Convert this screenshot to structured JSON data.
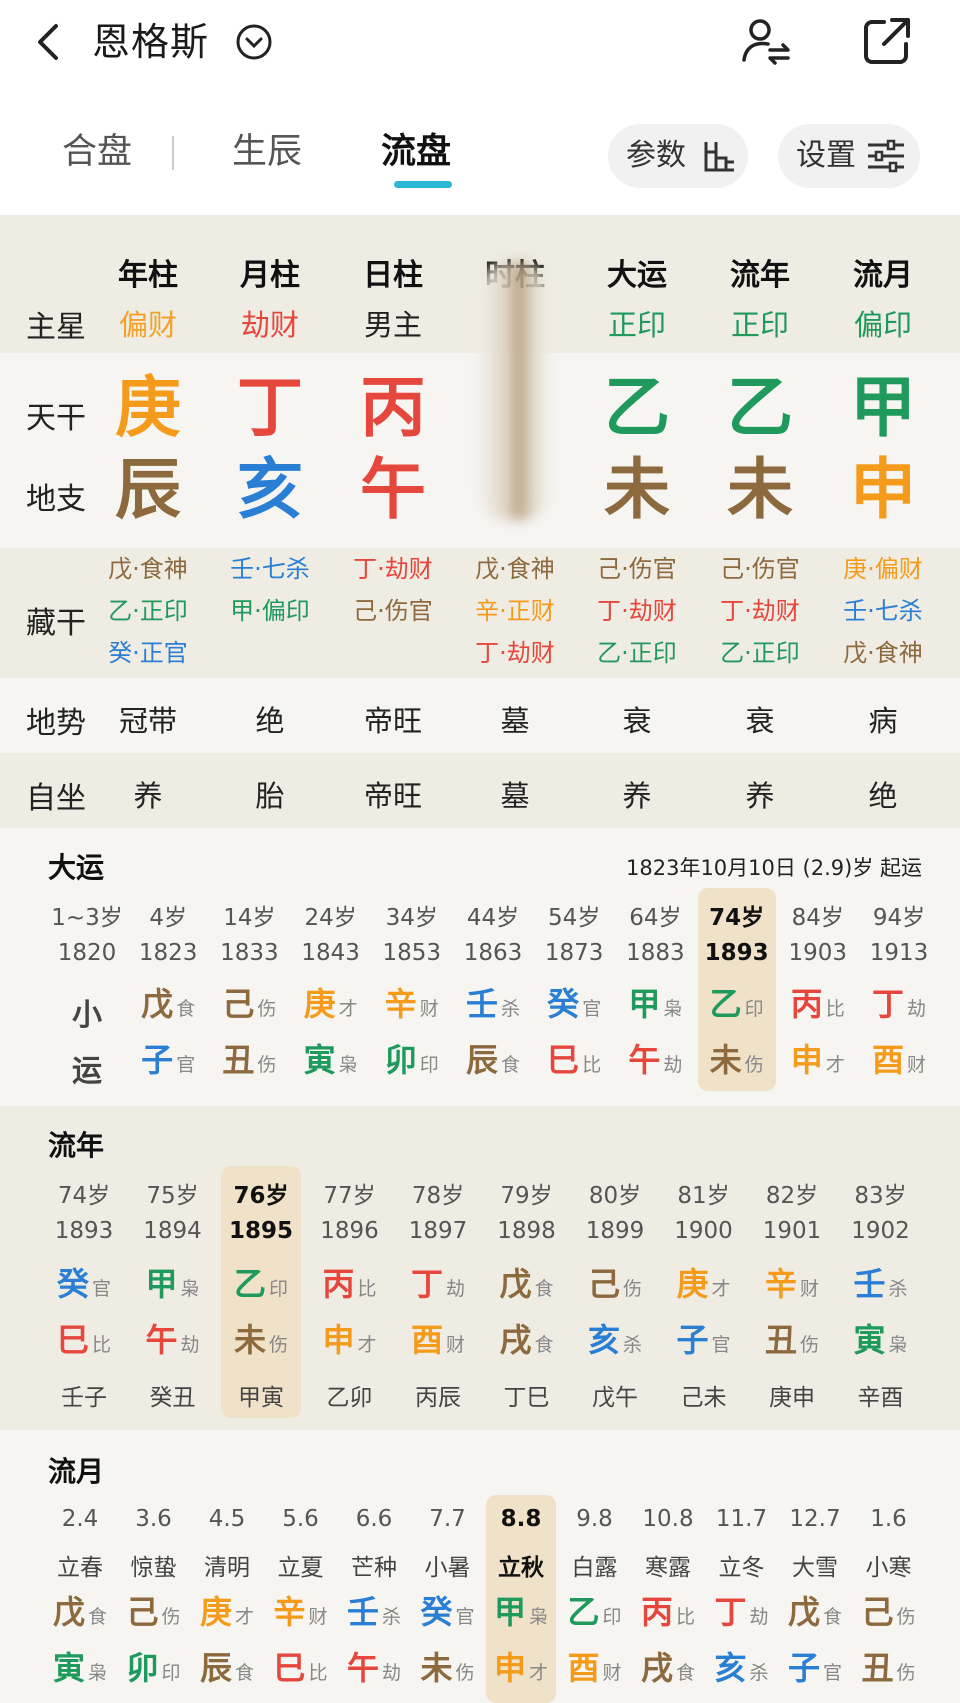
{
  "header": {
    "person_name": "恩格斯",
    "tabs": [
      "合盘",
      "生辰",
      "流盘"
    ],
    "active_tab": "流盘",
    "param_btn": "参数",
    "settings_btn": "设置"
  },
  "pillars": {
    "labels": {
      "star": "主星",
      "gan": "天干",
      "zhi": "地支",
      "hidden": "藏干",
      "dishi": "地势",
      "zizuo": "自坐"
    },
    "cols": [
      {
        "name": "年柱",
        "star": "偏财",
        "star_color": "#f2a22a",
        "gan": "庚",
        "gan_color": "#f59b1b",
        "zhi": "辰",
        "zhi_color": "#8c6a3e",
        "hidden": [
          {
            "t": "戊·食神",
            "c": "#8c6a3e"
          },
          {
            "t": "乙·正印",
            "c": "#1f9a5c"
          },
          {
            "t": "癸·正官",
            "c": "#2a7fd4"
          }
        ],
        "dishi": "冠带",
        "zizuo": "养"
      },
      {
        "name": "月柱",
        "star": "劫财",
        "star_color": "#e5473d",
        "gan": "丁",
        "gan_color": "#e5473d",
        "zhi": "亥",
        "zhi_color": "#2a7fd4",
        "hidden": [
          {
            "t": "壬·七杀",
            "c": "#2a7fd4"
          },
          {
            "t": "甲·偏印",
            "c": "#1f9a5c"
          }
        ],
        "dishi": "绝",
        "zizuo": "胎"
      },
      {
        "name": "日柱",
        "star": "男主",
        "star_color": "#222222",
        "gan": "丙",
        "gan_color": "#e5473d",
        "zhi": "午",
        "zhi_color": "#e5473d",
        "hidden": [
          {
            "t": "丁·劫财",
            "c": "#e5473d"
          },
          {
            "t": "己·伤官",
            "c": "#8c6a3e"
          }
        ],
        "dishi": "帝旺",
        "zizuo": "帝旺"
      },
      {
        "name": "时柱",
        "star": "",
        "star_color": "#222222",
        "gan": "",
        "gan_color": "#8c6a3e",
        "zhi": "",
        "zhi_color": "#8c6a3e",
        "hidden": [
          {
            "t": "戊·食神",
            "c": "#8c6a3e"
          },
          {
            "t": "辛·正财",
            "c": "#f59b1b"
          },
          {
            "t": "丁·劫财",
            "c": "#e5473d"
          }
        ],
        "dishi": "墓",
        "zizuo": "墓"
      },
      {
        "name": "大运",
        "star": "正印",
        "star_color": "#1f9a5c",
        "gan": "乙",
        "gan_color": "#1f9a5c",
        "zhi": "未",
        "zhi_color": "#8c6a3e",
        "hidden": [
          {
            "t": "己·伤官",
            "c": "#8c6a3e"
          },
          {
            "t": "丁·劫财",
            "c": "#e5473d"
          },
          {
            "t": "乙·正印",
            "c": "#1f9a5c"
          }
        ],
        "dishi": "衰",
        "zizuo": "养"
      },
      {
        "name": "流年",
        "star": "正印",
        "star_color": "#1f9a5c",
        "gan": "乙",
        "gan_color": "#1f9a5c",
        "zhi": "未",
        "zhi_color": "#8c6a3e",
        "hidden": [
          {
            "t": "己·伤官",
            "c": "#8c6a3e"
          },
          {
            "t": "丁·劫财",
            "c": "#e5473d"
          },
          {
            "t": "乙·正印",
            "c": "#1f9a5c"
          }
        ],
        "dishi": "衰",
        "zizuo": "养"
      },
      {
        "name": "流月",
        "star": "偏印",
        "star_color": "#1f9a5c",
        "gan": "甲",
        "gan_color": "#1f9a5c",
        "zhi": "申",
        "zhi_color": "#f59b1b",
        "hidden": [
          {
            "t": "庚·偏财",
            "c": "#f59b1b"
          },
          {
            "t": "壬·七杀",
            "c": "#2a7fd4"
          },
          {
            "t": "戊·食神",
            "c": "#8c6a3e"
          }
        ],
        "dishi": "病",
        "zizuo": "绝"
      }
    ]
  },
  "dayun": {
    "title": "大运",
    "start_info": "1823年10月10日 (2.9)岁 起运",
    "row_label_1": "小",
    "row_label_2": "运",
    "items": [
      {
        "age": "1~3岁",
        "year": "1820",
        "gan": "",
        "gs": "",
        "gc": "#222",
        "zhi": "",
        "zs": "",
        "zc": "#222"
      },
      {
        "age": "4岁",
        "year": "1823",
        "gan": "戊",
        "gs": "食",
        "gc": "#8c6a3e",
        "zhi": "子",
        "zs": "官",
        "zc": "#2a7fd4"
      },
      {
        "age": "14岁",
        "year": "1833",
        "gan": "己",
        "gs": "伤",
        "gc": "#8c6a3e",
        "zhi": "丑",
        "zs": "伤",
        "zc": "#8c6a3e"
      },
      {
        "age": "24岁",
        "year": "1843",
        "gan": "庚",
        "gs": "才",
        "gc": "#f59b1b",
        "zhi": "寅",
        "zs": "枭",
        "zc": "#1f9a5c"
      },
      {
        "age": "34岁",
        "year": "1853",
        "gan": "辛",
        "gs": "财",
        "gc": "#f59b1b",
        "zhi": "卯",
        "zs": "印",
        "zc": "#1f9a5c"
      },
      {
        "age": "44岁",
        "year": "1863",
        "gan": "壬",
        "gs": "杀",
        "gc": "#2a7fd4",
        "zhi": "辰",
        "zs": "食",
        "zc": "#8c6a3e"
      },
      {
        "age": "54岁",
        "year": "1873",
        "gan": "癸",
        "gs": "官",
        "gc": "#2a7fd4",
        "zhi": "巳",
        "zs": "比",
        "zc": "#e5473d"
      },
      {
        "age": "64岁",
        "year": "1883",
        "gan": "甲",
        "gs": "枭",
        "gc": "#1f9a5c",
        "zhi": "午",
        "zs": "劫",
        "zc": "#e5473d"
      },
      {
        "age": "74岁",
        "year": "1893",
        "gan": "乙",
        "gs": "印",
        "gc": "#1f9a5c",
        "zhi": "未",
        "zs": "伤",
        "zc": "#8c6a3e",
        "active": true
      },
      {
        "age": "84岁",
        "year": "1903",
        "gan": "丙",
        "gs": "比",
        "gc": "#e5473d",
        "zhi": "申",
        "zs": "才",
        "zc": "#f59b1b"
      },
      {
        "age": "94岁",
        "year": "1913",
        "gan": "丁",
        "gs": "劫",
        "gc": "#e5473d",
        "zhi": "酉",
        "zs": "财",
        "zc": "#f59b1b"
      }
    ]
  },
  "liunian": {
    "title": "流年",
    "items": [
      {
        "age": "74岁",
        "year": "1893",
        "gan": "癸",
        "gs": "官",
        "gc": "#2a7fd4",
        "zhi": "巳",
        "zs": "比",
        "zc": "#e5473d",
        "xy": "壬子"
      },
      {
        "age": "75岁",
        "year": "1894",
        "gan": "甲",
        "gs": "枭",
        "gc": "#1f9a5c",
        "zhi": "午",
        "zs": "劫",
        "zc": "#e5473d",
        "xy": "癸丑"
      },
      {
        "age": "76岁",
        "year": "1895",
        "gan": "乙",
        "gs": "印",
        "gc": "#1f9a5c",
        "zhi": "未",
        "zs": "伤",
        "zc": "#8c6a3e",
        "xy": "甲寅",
        "active": true
      },
      {
        "age": "77岁",
        "year": "1896",
        "gan": "丙",
        "gs": "比",
        "gc": "#e5473d",
        "zhi": "申",
        "zs": "才",
        "zc": "#f59b1b",
        "xy": "乙卯"
      },
      {
        "age": "78岁",
        "year": "1897",
        "gan": "丁",
        "gs": "劫",
        "gc": "#e5473d",
        "zhi": "酉",
        "zs": "财",
        "zc": "#f59b1b",
        "xy": "丙辰"
      },
      {
        "age": "79岁",
        "year": "1898",
        "gan": "戊",
        "gs": "食",
        "gc": "#8c6a3e",
        "zhi": "戌",
        "zs": "食",
        "zc": "#8c6a3e",
        "xy": "丁巳"
      },
      {
        "age": "80岁",
        "year": "1899",
        "gan": "己",
        "gs": "伤",
        "gc": "#8c6a3e",
        "zhi": "亥",
        "zs": "杀",
        "zc": "#2a7fd4",
        "xy": "戊午"
      },
      {
        "age": "81岁",
        "year": "1900",
        "gan": "庚",
        "gs": "才",
        "gc": "#f59b1b",
        "zhi": "子",
        "zs": "官",
        "zc": "#2a7fd4",
        "xy": "己未"
      },
      {
        "age": "82岁",
        "year": "1901",
        "gan": "辛",
        "gs": "财",
        "gc": "#f59b1b",
        "zhi": "丑",
        "zs": "伤",
        "zc": "#8c6a3e",
        "xy": "庚申"
      },
      {
        "age": "83岁",
        "year": "1902",
        "gan": "壬",
        "gs": "杀",
        "gc": "#2a7fd4",
        "zhi": "寅",
        "zs": "枭",
        "zc": "#1f9a5c",
        "xy": "辛酉"
      }
    ]
  },
  "liuyue": {
    "title": "流月",
    "items": [
      {
        "date": "2.4",
        "term": "立春",
        "gan": "戊",
        "gs": "食",
        "gc": "#8c6a3e",
        "zhi": "寅",
        "zs": "枭",
        "zc": "#1f9a5c"
      },
      {
        "date": "3.6",
        "term": "惊蛰",
        "gan": "己",
        "gs": "伤",
        "gc": "#8c6a3e",
        "zhi": "卯",
        "zs": "印",
        "zc": "#1f9a5c"
      },
      {
        "date": "4.5",
        "term": "清明",
        "gan": "庚",
        "gs": "才",
        "gc": "#f59b1b",
        "zhi": "辰",
        "zs": "食",
        "zc": "#8c6a3e"
      },
      {
        "date": "5.6",
        "term": "立夏",
        "gan": "辛",
        "gs": "财",
        "gc": "#f59b1b",
        "zhi": "巳",
        "zs": "比",
        "zc": "#e5473d"
      },
      {
        "date": "6.6",
        "term": "芒种",
        "gan": "壬",
        "gs": "杀",
        "gc": "#2a7fd4",
        "zhi": "午",
        "zs": "劫",
        "zc": "#e5473d"
      },
      {
        "date": "7.7",
        "term": "小暑",
        "gan": "癸",
        "gs": "官",
        "gc": "#2a7fd4",
        "zhi": "未",
        "zs": "伤",
        "zc": "#8c6a3e"
      },
      {
        "date": "8.8",
        "term": "立秋",
        "gan": "甲",
        "gs": "枭",
        "gc": "#1f9a5c",
        "zhi": "申",
        "zs": "才",
        "zc": "#f59b1b",
        "active": true
      },
      {
        "date": "9.8",
        "term": "白露",
        "gan": "乙",
        "gs": "印",
        "gc": "#1f9a5c",
        "zhi": "酉",
        "zs": "财",
        "zc": "#f59b1b"
      },
      {
        "date": "10.8",
        "term": "寒露",
        "gan": "丙",
        "gs": "比",
        "gc": "#e5473d",
        "zhi": "戌",
        "zs": "食",
        "zc": "#8c6a3e"
      },
      {
        "date": "11.7",
        "term": "立冬",
        "gan": "丁",
        "gs": "劫",
        "gc": "#e5473d",
        "zhi": "亥",
        "zs": "杀",
        "zc": "#2a7fd4"
      },
      {
        "date": "12.7",
        "term": "大雪",
        "gan": "戊",
        "gs": "食",
        "gc": "#8c6a3e",
        "zhi": "子",
        "zs": "官",
        "zc": "#2a7fd4"
      },
      {
        "date": "1.6",
        "term": "小寒",
        "gan": "己",
        "gs": "伤",
        "gc": "#8c6a3e",
        "zhi": "丑",
        "zs": "伤",
        "zc": "#8c6a3e"
      }
    ]
  }
}
